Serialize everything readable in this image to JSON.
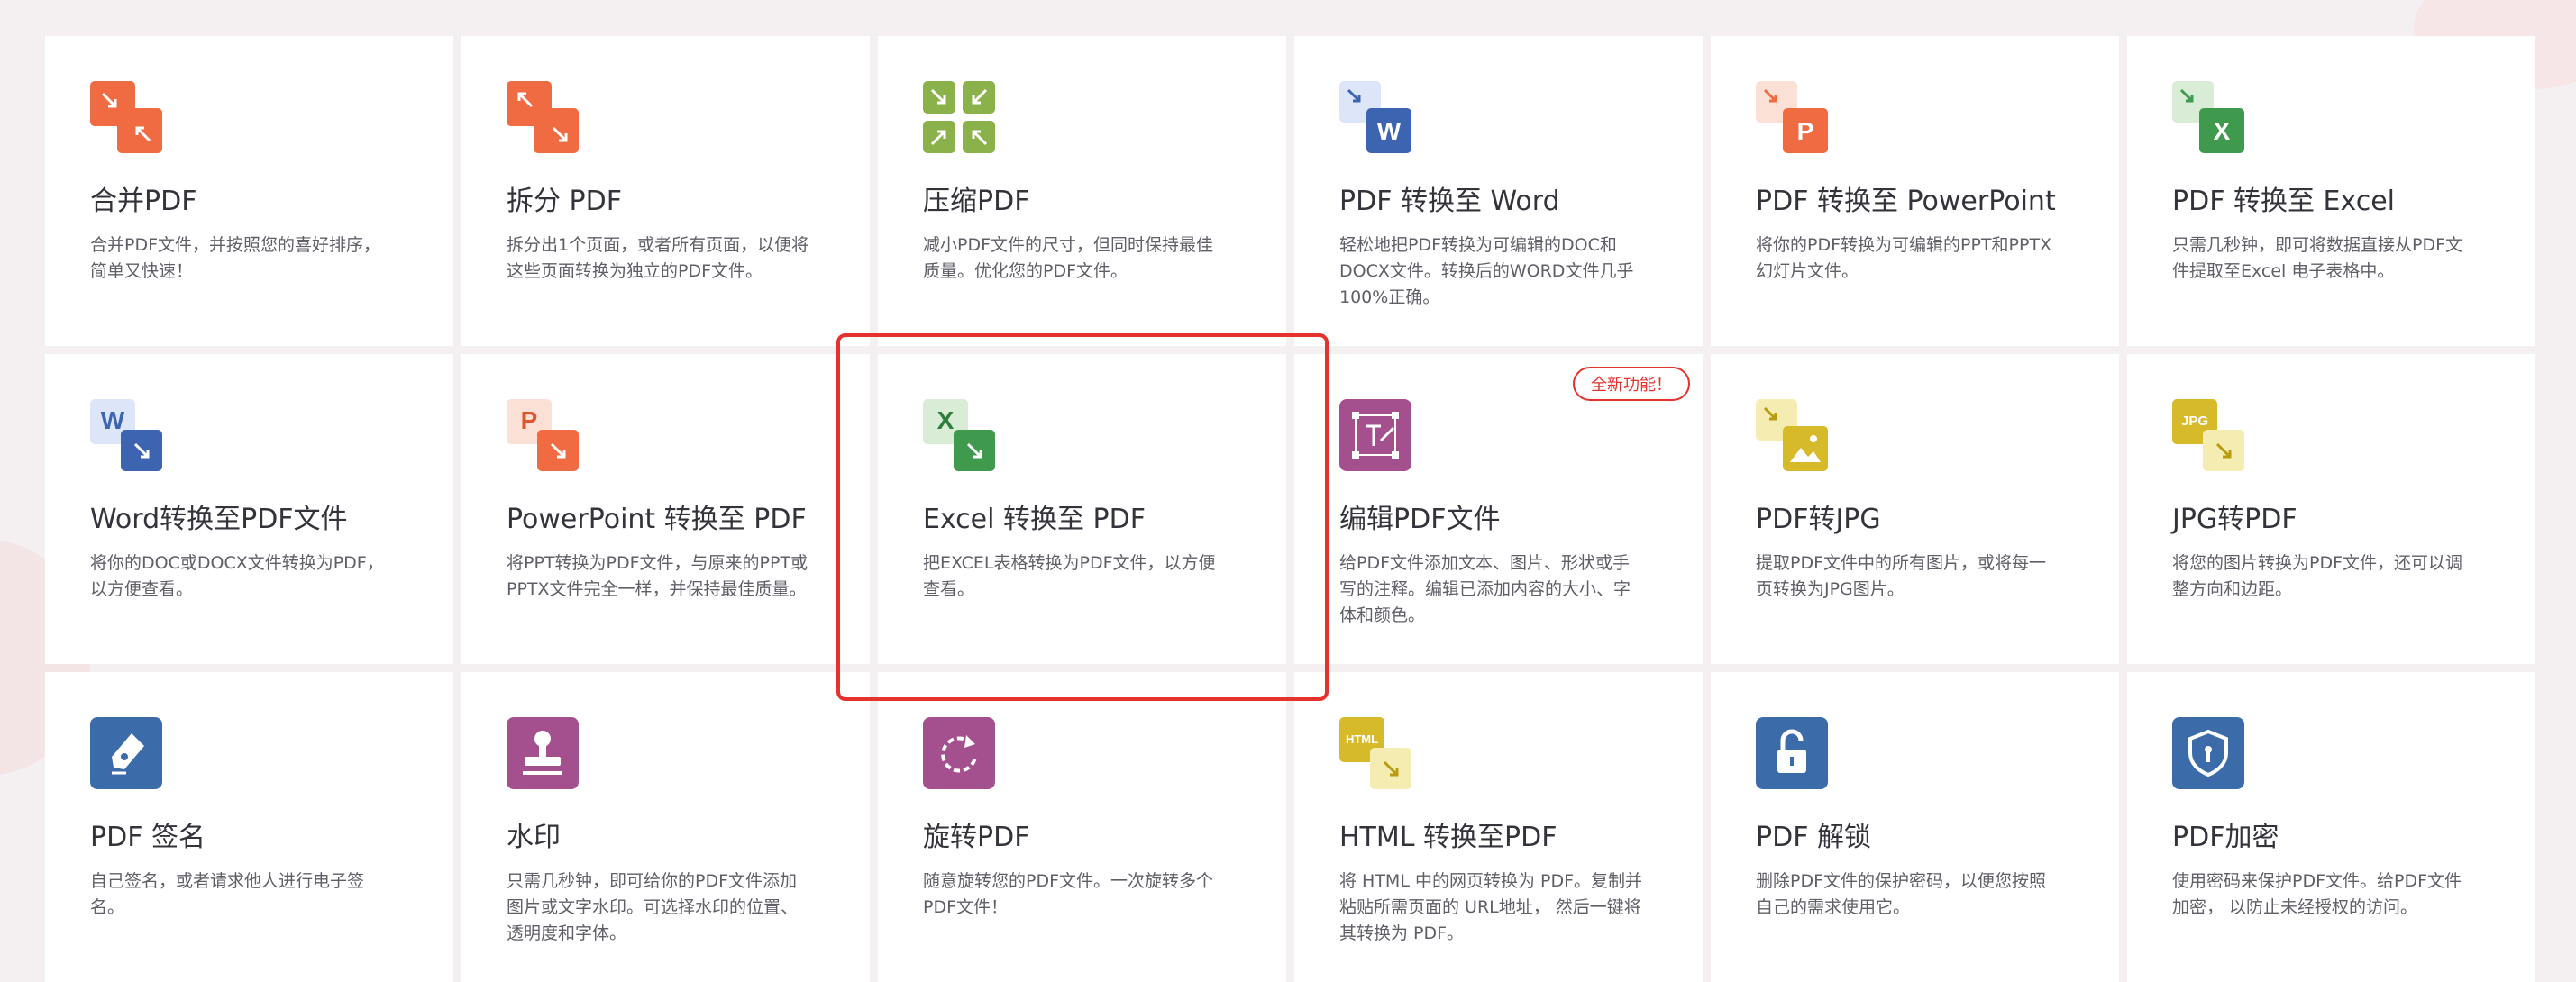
{
  "badge_new": "全新功能！",
  "tools": [
    {
      "title": "合并PDF",
      "desc": "合并PDF文件，并按照您的喜好排序，简单又快速！",
      "icon": "merge-icon"
    },
    {
      "title": "拆分 PDF",
      "desc": "拆分出1个页面，或者所有页面，以便将这些页面转换为独立的PDF文件。",
      "icon": "split-icon"
    },
    {
      "title": "压缩PDF",
      "desc": "减小PDF文件的尺寸，但同时保持最佳质量。优化您的PDF文件。",
      "icon": "compress-icon"
    },
    {
      "title": "PDF 转换至 Word",
      "desc": "轻松地把PDF转换为可编辑的DOC和DOCX文件。转换后的WORD文件几乎100%正确。",
      "icon": "pdf-to-word-icon"
    },
    {
      "title": "PDF 转换至 PowerPoint",
      "desc": "将你的PDF转换为可编辑的PPT和PPTX幻灯片文件。",
      "icon": "pdf-to-powerpoint-icon"
    },
    {
      "title": "PDF 转换至 Excel",
      "desc": "只需几秒钟，即可将数据直接从PDF文件提取至Excel 电子表格中。",
      "icon": "pdf-to-excel-icon"
    },
    {
      "title": "Word转换至PDF文件",
      "desc": "将你的DOC或DOCX文件转换为PDF，以方便查看。",
      "icon": "word-to-pdf-icon"
    },
    {
      "title": "PowerPoint 转换至 PDF",
      "desc": "将PPT转换为PDF文件，与原来的PPT或PPTX文件完全一样，并保持最佳质量。",
      "icon": "powerpoint-to-pdf-icon"
    },
    {
      "title": "Excel 转换至 PDF",
      "desc": "把EXCEL表格转换为PDF文件，以方便查看。",
      "icon": "excel-to-pdf-icon"
    },
    {
      "title": "编辑PDF文件",
      "desc": "给PDF文件添加文本、图片、形状或手写的注释。编辑已添加内容的大小、字体和颜色。",
      "icon": "edit-pdf-icon"
    },
    {
      "title": "PDF转JPG",
      "desc": "提取PDF文件中的所有图片，或将每一页转换为JPG图片。",
      "icon": "pdf-to-jpg-icon"
    },
    {
      "title": "JPG转PDF",
      "desc": "将您的图片转换为PDF文件，还可以调整方向和边距。",
      "icon": "jpg-to-pdf-icon"
    },
    {
      "title": "PDF 签名",
      "desc": "自己签名，或者请求他人进行电子签名。",
      "icon": "sign-pdf-icon"
    },
    {
      "title": "水印",
      "desc": "只需几秒钟，即可给你的PDF文件添加图片或文字水印。可选择水印的位置、透明度和字体。",
      "icon": "watermark-icon"
    },
    {
      "title": "旋转PDF",
      "desc": "随意旋转您的PDF文件。一次旋转多个PDF文件！",
      "icon": "rotate-icon"
    },
    {
      "title": "HTML 转换至PDF",
      "desc": "将 HTML 中的网页转换为 PDF。复制并粘贴所需页面的 URL地址， 然后一键将其转换为 PDF。",
      "icon": "html-to-pdf-icon"
    },
    {
      "title": "PDF 解锁",
      "desc": "删除PDF文件的保护密码，以便您按照自己的需求使用它。",
      "icon": "unlock-icon"
    },
    {
      "title": "PDF加密",
      "desc": "使用密码来保护PDF文件。给PDF文件加密， 以防止未经授权的访问。",
      "icon": "protect-icon"
    }
  ],
  "icon_labels": {
    "word": "W",
    "ppt": "P",
    "excel": "X",
    "html": "HTML",
    "jpg": "JPG"
  }
}
